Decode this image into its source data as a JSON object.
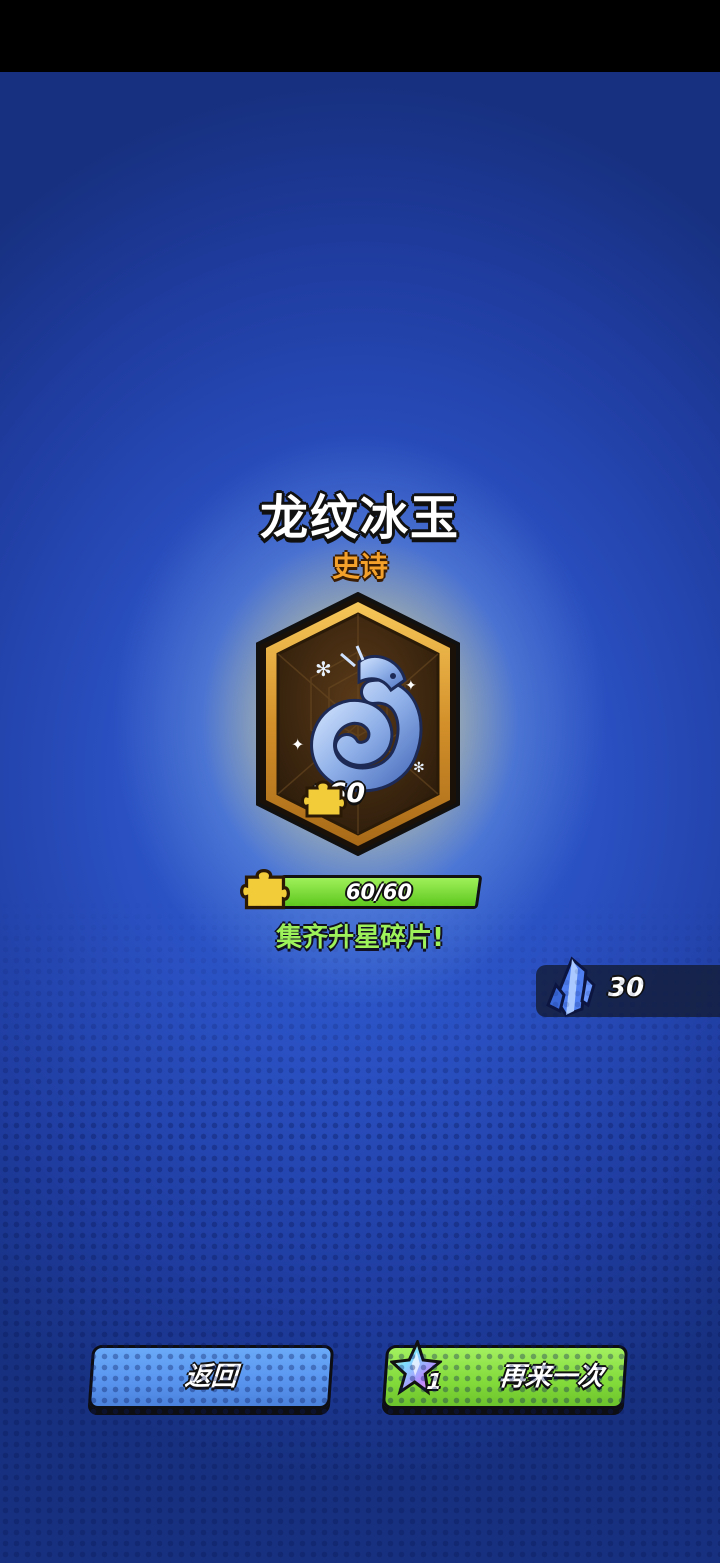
{
  "item": {
    "name": "龙纹冰玉",
    "rarity": "史诗",
    "reward_count": "+60",
    "icon": "ice-jade-dragon-icon"
  },
  "progress": {
    "text": "60/60",
    "current": 60,
    "max": 60,
    "fraction": 1.0,
    "icon": "puzzle-piece-icon"
  },
  "status_message": "集齐升星碎片!",
  "currency": {
    "icon": "blue-crystal-icon",
    "value": "30"
  },
  "buttons": {
    "back_label": "返回",
    "again_label": "再来一次",
    "again_cost": "1",
    "again_cost_icon": "rainbow-star-gem-icon"
  },
  "colors": {
    "rarity": "#f3a12a",
    "progress_fill": "#7ad832",
    "status": "#9ef25a",
    "back_button": "#5a96f0",
    "again_button": "#84dc3c"
  }
}
